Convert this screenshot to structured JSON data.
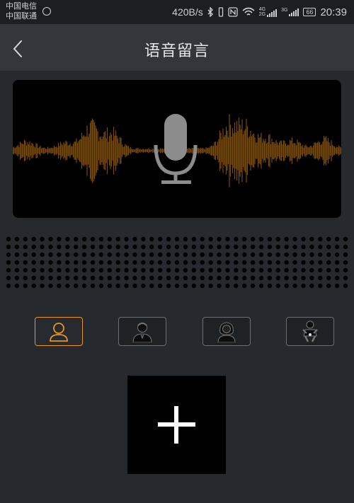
{
  "status_bar": {
    "carrier_1": "中国电信",
    "carrier_2": "中国联通",
    "net_speed": "420B/s",
    "net_type_1": "4G",
    "net_type_2": "2G",
    "net_type_3": "3G",
    "battery": "66",
    "time": "20:39"
  },
  "header": {
    "title": "语音留言",
    "back_icon": "chevron-left-icon"
  },
  "recorder": {
    "mic_icon": "microphone-icon",
    "waveform_color": "#7a4a0c"
  },
  "voice_options": [
    {
      "name": "default-voice",
      "icon": "person-outline-icon",
      "selected": true
    },
    {
      "name": "male-voice",
      "icon": "man-icon",
      "selected": false
    },
    {
      "name": "female-voice",
      "icon": "woman-icon",
      "selected": false
    },
    {
      "name": "child-voice",
      "icon": "baby-icon",
      "selected": false
    }
  ],
  "add": {
    "icon": "plus-icon"
  },
  "colors": {
    "accent": "#e8961f",
    "background": "#262a2e",
    "header": "#33373c"
  }
}
